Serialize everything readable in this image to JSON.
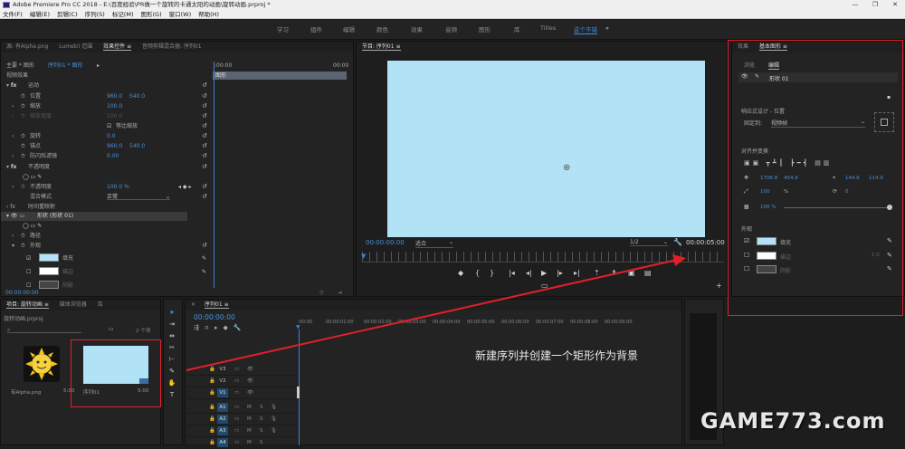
{
  "title_bar": {
    "text": "Adobe Premiere Pro CC 2018 - E:\\百度经验\\PR做一个旋转的卡通太阳的动画\\旋转动画.prproj *",
    "min": "—",
    "max": "❐",
    "close": "✕"
  },
  "menu": [
    "文件(F)",
    "编辑(E)",
    "剪辑(C)",
    "序列(S)",
    "标记(M)",
    "图形(G)",
    "窗口(W)",
    "帮助(H)"
  ],
  "workspaces": [
    {
      "label": "学习",
      "active": false
    },
    {
      "label": "组件",
      "active": false
    },
    {
      "label": "编辑",
      "active": false
    },
    {
      "label": "颜色",
      "active": false
    },
    {
      "label": "效果",
      "active": false
    },
    {
      "label": "音频",
      "active": false
    },
    {
      "label": "图形",
      "active": false
    },
    {
      "label": "库",
      "active": false
    },
    {
      "label": "Titles",
      "active": false
    },
    {
      "label": "这个不错",
      "active": true
    }
  ],
  "workspace_more": "»",
  "effect_controls": {
    "tabs": [
      "源: 有Alpha.png",
      "Lumetri 范围",
      "效果控件 ≡",
      "音频剪辑混合器: 序列01"
    ],
    "source": "主要 * 图形",
    "sequence": "序列01 * 图形",
    "tl_start": ":00:00",
    "tl_end": "00:00",
    "clip_label": "图形",
    "video_effects": "视频效果",
    "motion": "运动",
    "position": "位置",
    "position_x": "960.0",
    "position_y": "540.0",
    "scale": "缩放",
    "scale_value": "100.0",
    "scale_width": "缩放宽度",
    "scale_width_value": "100.0",
    "uniform_scale": "等比缩放",
    "rotation": "旋转",
    "rotation_value": "0.0",
    "anchor": "锚点",
    "anchor_x": "960.0",
    "anchor_y": "540.0",
    "antiflicker": "防闪烁滤镜",
    "antiflicker_value": "0.00",
    "opacity_group": "不透明度",
    "opacity": "不透明度",
    "opacity_value": "100.0 %",
    "blend_mode": "混合模式",
    "blend_value": "正常",
    "time_remap": "时间重映射",
    "shape": "形状 (形状 01)",
    "path": "路径",
    "appearance": "外观",
    "fill": "填充",
    "stroke": "描边",
    "shadow": "阴影",
    "timecode": "00:00:00:00"
  },
  "program": {
    "title": "节目: 序列01 ≡",
    "timecode": "00:00:00:00",
    "fit": "适合",
    "resolution": "1/2",
    "duration": "00:00:05:00",
    "frame_color": "#b2e2f5"
  },
  "essential_graphics": {
    "tabs": [
      "效果",
      "基本图形 ≡"
    ],
    "subtabs": [
      "浏览",
      "编辑"
    ],
    "layer": "形状 01",
    "responsive_label": "响应式设计 - 位置",
    "pin_label": "固定到:",
    "pin_value": "视频帧",
    "align_label": "对齐并变换",
    "pos_x": "1706.8",
    "pos_y": "454.9",
    "anchor_x": "144.6",
    "anchor_y": "114.9",
    "scale": "100",
    "scale_pct": "%",
    "rotation": "0",
    "opacity": "100 %",
    "appearance": "外观",
    "fill": "填充",
    "stroke": "描边",
    "stroke_width": "1.0",
    "shadow": "阴影",
    "fill_color": "#b2e2f5"
  },
  "project": {
    "tabs": [
      "项目: 旋转动画 ≡",
      "媒体浏览器",
      "库"
    ],
    "file": "旋转动画.prproj",
    "count": "2 个项",
    "items": [
      {
        "name": "有Alpha.png",
        "duration": "5:00"
      },
      {
        "name": "序列01",
        "duration": "5:00"
      }
    ]
  },
  "timeline": {
    "title": "序列01 ≡",
    "timecode": "00:00:00:00",
    "ruler": [
      ":00:00",
      "00:00:01:00",
      "00:00:02:00",
      "00:00:03:00",
      "00:00:04:00",
      "00:00:05:00",
      "00:00:06:00",
      "00:00:07:00",
      "00:00:08:00",
      "00:00:09:00"
    ],
    "tracks": [
      "V3",
      "V2",
      "V1",
      "A1",
      "A2",
      "A3",
      "A4"
    ]
  },
  "annotation": "新建序列并创建一个矩形作为背景",
  "watermark": "GAME773.com"
}
